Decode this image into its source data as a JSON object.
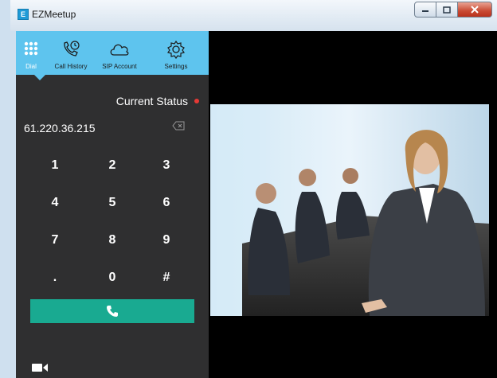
{
  "window": {
    "title": "EZMeetup",
    "app_icon_letter": "E"
  },
  "controls": {
    "minimize_icon": "minimize-icon",
    "maximize_icon": "maximize-icon",
    "close_icon": "close-icon"
  },
  "nav": {
    "items": [
      {
        "label": "Dial",
        "icon": "dialpad-icon",
        "active": true
      },
      {
        "label": "Call History",
        "icon": "call-history-icon"
      },
      {
        "label": "SIP Account",
        "icon": "cloud-icon"
      },
      {
        "label": "Settings",
        "icon": "gear-icon"
      }
    ]
  },
  "status": {
    "label": "Current Status",
    "dot_color": "#e53935"
  },
  "dial": {
    "number": "61.220.36.215",
    "keys": [
      "1",
      "2",
      "3",
      "4",
      "5",
      "6",
      "7",
      "8",
      "9",
      ".",
      "0",
      "#"
    ]
  },
  "colors": {
    "accent": "#5ec4ee",
    "call": "#19aa91",
    "panel": "#2f2f30"
  },
  "video": {
    "description": "business people meeting"
  }
}
